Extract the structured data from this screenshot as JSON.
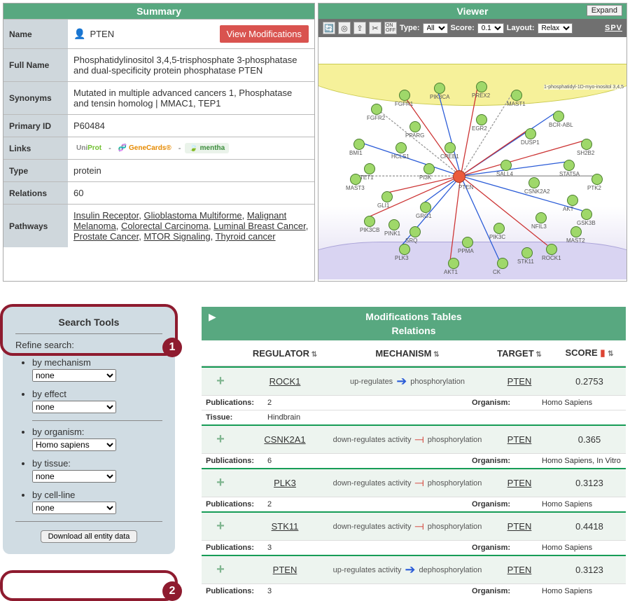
{
  "summary": {
    "header": "Summary",
    "rows": {
      "name_label": "Name",
      "name_value": "PTEN",
      "view_mod_btn": "View Modifications",
      "fullname_label": "Full Name",
      "fullname_value": "Phosphatidylinositol 3,4,5-trisphosphate 3-phosphatase and dual-specificity protein phosphatase PTEN",
      "synonyms_label": "Synonyms",
      "synonyms_value": "Mutated in multiple advanced cancers 1, Phosphatase and tensin homolog | MMAC1, TEP1",
      "primaryid_label": "Primary ID",
      "primaryid_value": "P60484",
      "links_label": "Links",
      "links_uniprot": "UniProt",
      "links_genecards": "GeneCards",
      "links_mentha": "mentha",
      "type_label": "Type",
      "type_value": "protein",
      "relations_label": "Relations",
      "relations_value": "60",
      "pathways_label": "Pathways"
    },
    "pathways": [
      "Insulin Receptor",
      "Glioblastoma Multiforme",
      "Malignant Melanoma",
      "Colorectal Carcinoma",
      "Luminal Breast Cancer",
      "Prostate Cancer",
      "MTOR Signaling",
      "Thyroid cancer"
    ]
  },
  "viewer": {
    "header": "Viewer",
    "expand_btn": "Expand",
    "toolbar": {
      "type_label": "Type:",
      "type_value": "All",
      "score_label": "Score:",
      "score_value": "0.1",
      "layout_label": "Layout:",
      "layout_value": "Relax",
      "spv": "SPV",
      "center_node": "PTEN",
      "visible_nodes": [
        "FGFR2",
        "FGFR1",
        "PIK3CA",
        "PREX2",
        "MAST1",
        "BCR-ABL",
        "SH2B2",
        "PTK2",
        "GSK3B",
        "ROCK1",
        "CK",
        "AKT1",
        "PLK3",
        "PIK3CB",
        "MAST3",
        "BMI1",
        "DUSP1",
        "GRG1",
        "GLI1",
        "STAT5A",
        "PPARG",
        "NFIL3",
        "EGR2",
        "CREB1",
        "SALL4",
        "PI3K",
        "CSNK2A2",
        "SRQ",
        "MAST2",
        "TET1",
        "HCLS1",
        "PPMA",
        "PIK3C",
        "AKT",
        "PINK1",
        "STK11"
      ],
      "annotation_text": "1-phosphatidyl-1D-myo-inositol 3,4,5"
    }
  },
  "search": {
    "title": "Search Tools",
    "refine": "Refine search:",
    "filters": [
      {
        "label": "by mechanism",
        "value": "none"
      },
      {
        "label": "by effect",
        "value": "none"
      },
      {
        "label": "by organism:",
        "value": "Homo sapiens"
      },
      {
        "label": "by tissue:",
        "value": "none"
      },
      {
        "label": "by cell-line",
        "value": "none"
      }
    ],
    "download_btn": "Download all entity data",
    "callout1": "1",
    "callout2": "2"
  },
  "mod": {
    "title1": "Modifications Tables",
    "title2": "Relations",
    "columns": {
      "reg": "REGULATOR",
      "mech": "MECHANISM",
      "target": "TARGET",
      "score": "SCORE"
    },
    "rows": [
      {
        "regulator": "ROCK1",
        "mech_left": "up-regulates",
        "mech_dir": "up",
        "mech_right": "phosphorylation",
        "target": "PTEN",
        "score": "0.2753",
        "pubs": "2",
        "org": "Homo Sapiens",
        "tissue": "Hindbrain"
      },
      {
        "regulator": "CSNK2A1",
        "mech_left": "down-regulates activity",
        "mech_dir": "down",
        "mech_right": "phosphorylation",
        "target": "PTEN",
        "score": "0.365",
        "pubs": "6",
        "org": "Homo Sapiens, In Vitro"
      },
      {
        "regulator": "PLK3",
        "mech_left": "down-regulates activity",
        "mech_dir": "down",
        "mech_right": "phosphorylation",
        "target": "PTEN",
        "score": "0.3123",
        "pubs": "2",
        "org": "Homo Sapiens"
      },
      {
        "regulator": "STK11",
        "mech_left": "down-regulates activity",
        "mech_dir": "down",
        "mech_right": "phosphorylation",
        "target": "PTEN",
        "score": "0.4418",
        "pubs": "3",
        "org": "Homo Sapiens"
      },
      {
        "regulator": "PTEN",
        "mech_left": "up-regulates activity",
        "mech_dir": "up",
        "mech_right": "dephosphorylation",
        "target": "PTEN",
        "score": "0.3123",
        "pubs": "3",
        "org": "Homo Sapiens"
      }
    ],
    "sub_pub_label": "Publications:",
    "sub_org_label": "Organism:",
    "sub_tissue_label": "Tissue:"
  }
}
